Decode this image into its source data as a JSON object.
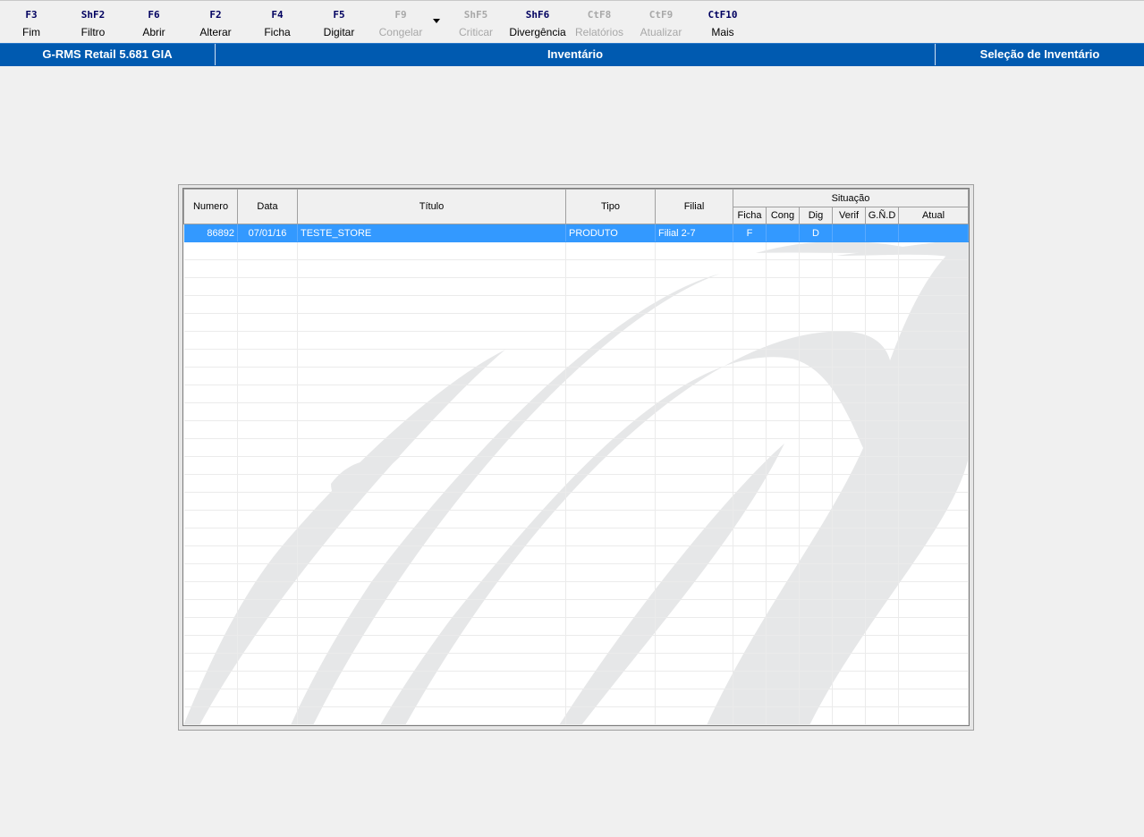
{
  "toolbar": {
    "buttons": [
      {
        "key": "F3",
        "label": "Fim",
        "enabled": true
      },
      {
        "key": "ShF2",
        "label": "Filtro",
        "enabled": true
      },
      {
        "key": "F6",
        "label": "Abrir",
        "enabled": true
      },
      {
        "key": "F2",
        "label": "Alterar",
        "enabled": true
      },
      {
        "key": "F4",
        "label": "Ficha",
        "enabled": true
      },
      {
        "key": "F5",
        "label": "Digitar",
        "enabled": true
      },
      {
        "key": "F9",
        "label": "Congelar",
        "enabled": false
      },
      {
        "key": "ShF5",
        "label": "Criticar",
        "enabled": false
      },
      {
        "key": "ShF6",
        "label": "Divergência",
        "enabled": true
      },
      {
        "key": "CtF8",
        "label": "Relatórios",
        "enabled": false
      },
      {
        "key": "CtF9",
        "label": "Atualizar",
        "enabled": false
      },
      {
        "key": "CtF10",
        "label": "Mais",
        "enabled": true
      }
    ]
  },
  "titlebar": {
    "app": "G-RMS Retail 5.681 GIA",
    "title": "Inventário",
    "section": "Seleção de Inventário"
  },
  "table": {
    "headers": {
      "numero": "Numero",
      "data": "Data",
      "titulo": "Título",
      "tipo": "Tipo",
      "filial": "Filial",
      "situacao": "Situação",
      "ficha": "Ficha",
      "cong": "Cong",
      "dig": "Dig",
      "verif": "Verif",
      "gnd": "G.Ñ.D",
      "atual": "Atual"
    },
    "rows": [
      {
        "numero": "86892",
        "data": "07/01/16",
        "titulo": "TESTE_STORE",
        "tipo": "PRODUTO",
        "filial": "Filial 2-7",
        "ficha": "F",
        "cong": "",
        "dig": "D",
        "verif": "",
        "gnd": "",
        "atual": ""
      }
    ]
  },
  "colors": {
    "titlebar": "#005ab0",
    "selection": "#3399ff",
    "watermark": "#e6e7e8"
  }
}
